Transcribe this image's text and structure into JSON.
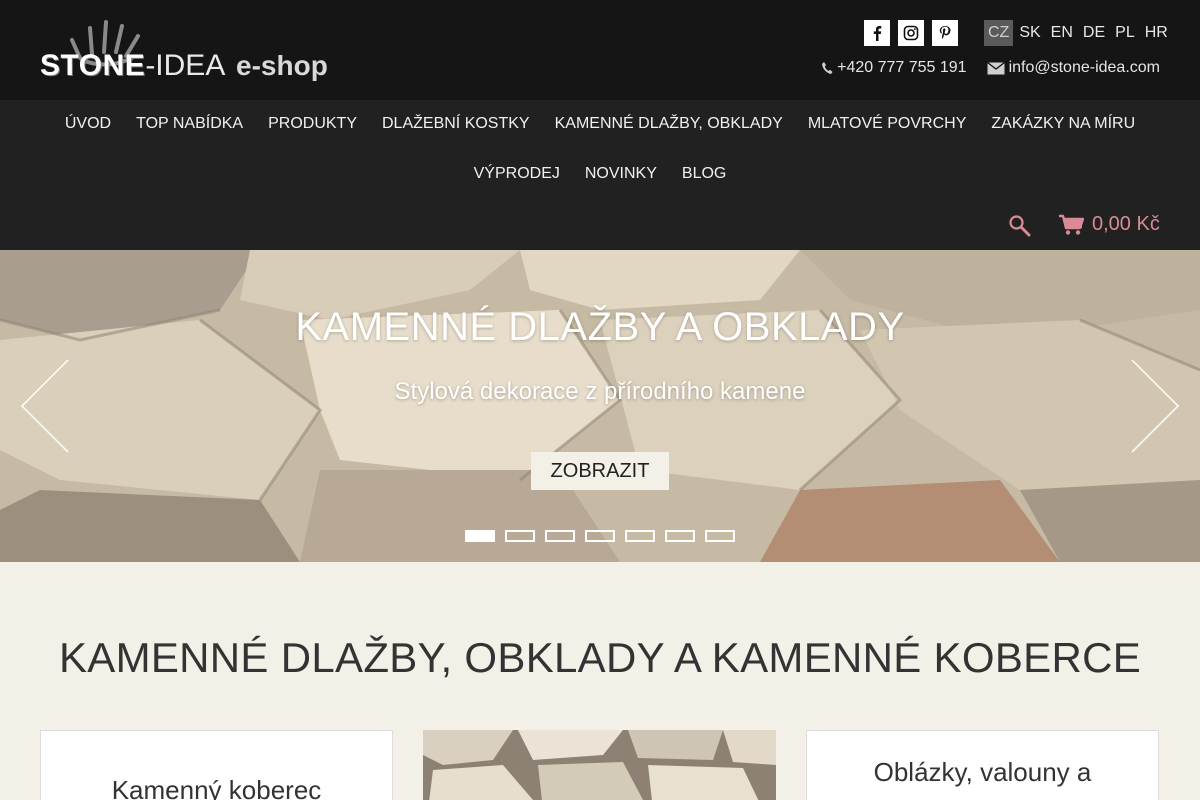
{
  "header": {
    "logo": {
      "stone": "STONE",
      "idea": "-IDEA",
      "eshop": "e-shop"
    },
    "social": [
      {
        "name": "facebook-icon",
        "glyph": "f"
      },
      {
        "name": "instagram-icon",
        "glyph": ""
      },
      {
        "name": "pinterest-icon",
        "glyph": ""
      }
    ],
    "languages": [
      "CZ",
      "SK",
      "EN",
      "DE",
      "PL",
      "HR"
    ],
    "active_language": "CZ",
    "phone": "+420 777 755 191",
    "email": "info@stone-idea.com"
  },
  "nav": {
    "row1": [
      "ÚVOD",
      "TOP NABÍDKA",
      "PRODUKTY",
      "DLAŽEBNÍ KOSTKY",
      "KAMENNÉ DLAŽBY, OBKLADY",
      "MLATOVÉ POVRCHY",
      "ZAKÁZKY NA MÍRU"
    ],
    "row2": [
      "VÝPRODEJ",
      "NOVINKY",
      "BLOG"
    ],
    "cart_total": "0,00 Kč"
  },
  "hero": {
    "title": "KAMENNÉ DLAŽBY A OBKLADY",
    "subtitle": "Stylová dekorace z přírodního kamene",
    "button": "ZOBRAZIT",
    "slide_count": 7,
    "active_slide": 1
  },
  "main": {
    "section_title": "KAMENNÉ DLAŽBY, OBKLADY A KAMENNÉ KOBERCE",
    "cards": [
      {
        "title": "Kamenný koberec"
      },
      {
        "title": ""
      },
      {
        "title": "Oblázky, valouny a"
      }
    ]
  },
  "colors": {
    "topbar": "#151515",
    "nav": "#212121",
    "accent": "#d98a96",
    "page_bg": "#f3f0e8"
  }
}
